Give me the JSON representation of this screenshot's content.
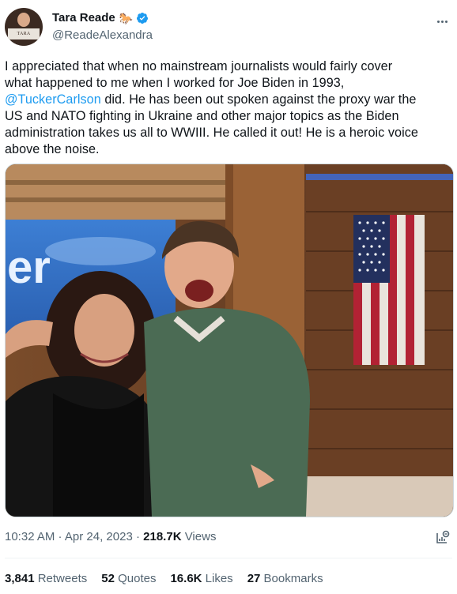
{
  "author": {
    "display_name": "Tara Reade",
    "emoji": "🐎",
    "handle": "@ReadeAlexandra",
    "avatar_text": "TARA READE",
    "verified_color": "#1d9bf0"
  },
  "tweet": {
    "lines": [
      "I appreciated that when no mainstream journalists would fairly cover",
      "what happened to me when I worked for Joe Biden in 1993,"
    ],
    "mention": "@TuckerCarlson",
    "mention_rest": " did. He has been out spoken against the proxy war the",
    "lines_after": [
      "US and NATO fighting in Ukraine and other major topics as the Biden",
      "administration takes us all to WWIII. He called it out! He is a heroic voice",
      "above the noise."
    ]
  },
  "photo": {
    "backdrop_text": "er",
    "flag": "american-flag"
  },
  "meta": {
    "time": "10:32 AM",
    "separator": " · ",
    "date": "Apr 24, 2023",
    "views_count": "218.7K",
    "views_label": " Views"
  },
  "stats": [
    {
      "count": "3,841",
      "label": " Retweets"
    },
    {
      "count": "52",
      "label": " Quotes"
    },
    {
      "count": "16.6K",
      "label": " Likes"
    },
    {
      "count": "27",
      "label": " Bookmarks"
    }
  ]
}
